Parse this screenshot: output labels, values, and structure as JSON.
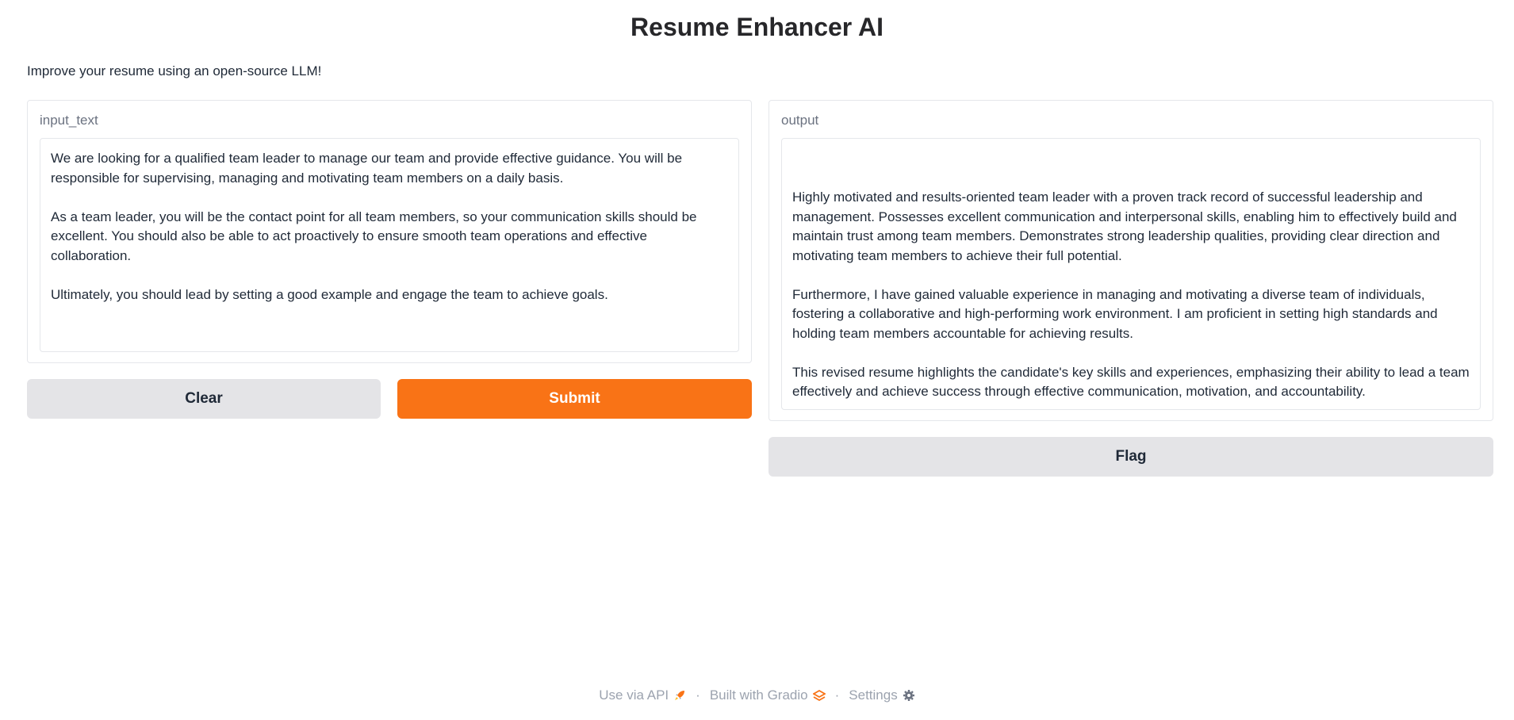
{
  "header": {
    "title": "Resume Enhancer AI",
    "description": "Improve your resume using an open-source LLM!"
  },
  "input": {
    "label": "input_text",
    "value": "We are looking for a qualified team leader to manage our team and provide effective guidance. You will be responsible for supervising, managing and motivating team members on a daily basis.\n\nAs a team leader, you will be the contact point for all team members, so your communication skills should be excellent. You should also be able to act proactively to ensure smooth team operations and effective collaboration.\n\nUltimately, you should lead by setting a good example and engage the team to achieve goals."
  },
  "output": {
    "label": "output",
    "value": "\n\nHighly motivated and results-oriented team leader with a proven track record of successful leadership and management. Possesses excellent communication and interpersonal skills, enabling him to effectively build and maintain trust among team members. Demonstrates strong leadership qualities, providing clear direction and motivating team members to achieve their full potential.\n\nFurthermore, I have gained valuable experience in managing and motivating a diverse team of individuals, fostering a collaborative and high-performing work environment. I am proficient in setting high standards and holding team members accountable for achieving results.\n\nThis revised resume highlights the candidate's key skills and experiences, emphasizing their ability to lead a team effectively and achieve success through effective communication, motivation, and accountability."
  },
  "buttons": {
    "clear": "Clear",
    "submit": "Submit",
    "flag": "Flag"
  },
  "footer": {
    "api": "Use via API",
    "built": "Built with Gradio",
    "settings": "Settings",
    "separator": "·",
    "icons": [
      "rocket-icon",
      "gradio-logo-icon",
      "gear-icon"
    ]
  },
  "colors": {
    "primary": "#f97316",
    "secondary": "#e4e4e7",
    "border": "#e5e7eb"
  }
}
